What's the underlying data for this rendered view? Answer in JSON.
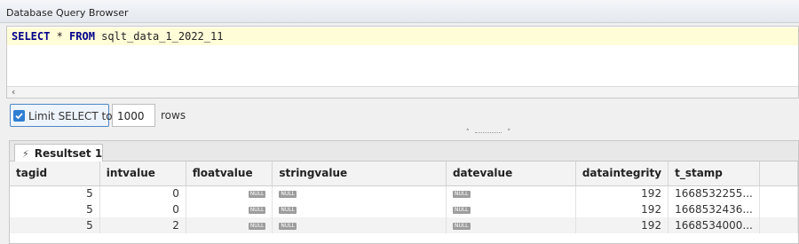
{
  "window": {
    "title": "Database Query Browser"
  },
  "query": {
    "keyword_select": "SELECT",
    "star": " * ",
    "keyword_from": "FROM",
    "table": " sqlt_data_1_2022_11"
  },
  "limit": {
    "checked": true,
    "label": "Limit SELECT to:",
    "value": "1000",
    "rows_label": "rows"
  },
  "results": {
    "tab_label": "Resultset 1",
    "columns": [
      "tagid",
      "intvalue",
      "floatvalue",
      "stringvalue",
      "datevalue",
      "dataintegrity",
      "t_stamp"
    ],
    "null_badge": "NULL",
    "rows": [
      {
        "tagid": "5",
        "intvalue": "0",
        "dataintegrity": "192",
        "t_stamp": "1668532255..."
      },
      {
        "tagid": "5",
        "intvalue": "0",
        "dataintegrity": "192",
        "t_stamp": "1668532436..."
      },
      {
        "tagid": "5",
        "intvalue": "2",
        "dataintegrity": "192",
        "t_stamp": "1668534000..."
      }
    ]
  },
  "colors": {
    "accent": "#2e7ed2",
    "query_highlight": "#fffcd8",
    "keyword": "#00008b"
  }
}
